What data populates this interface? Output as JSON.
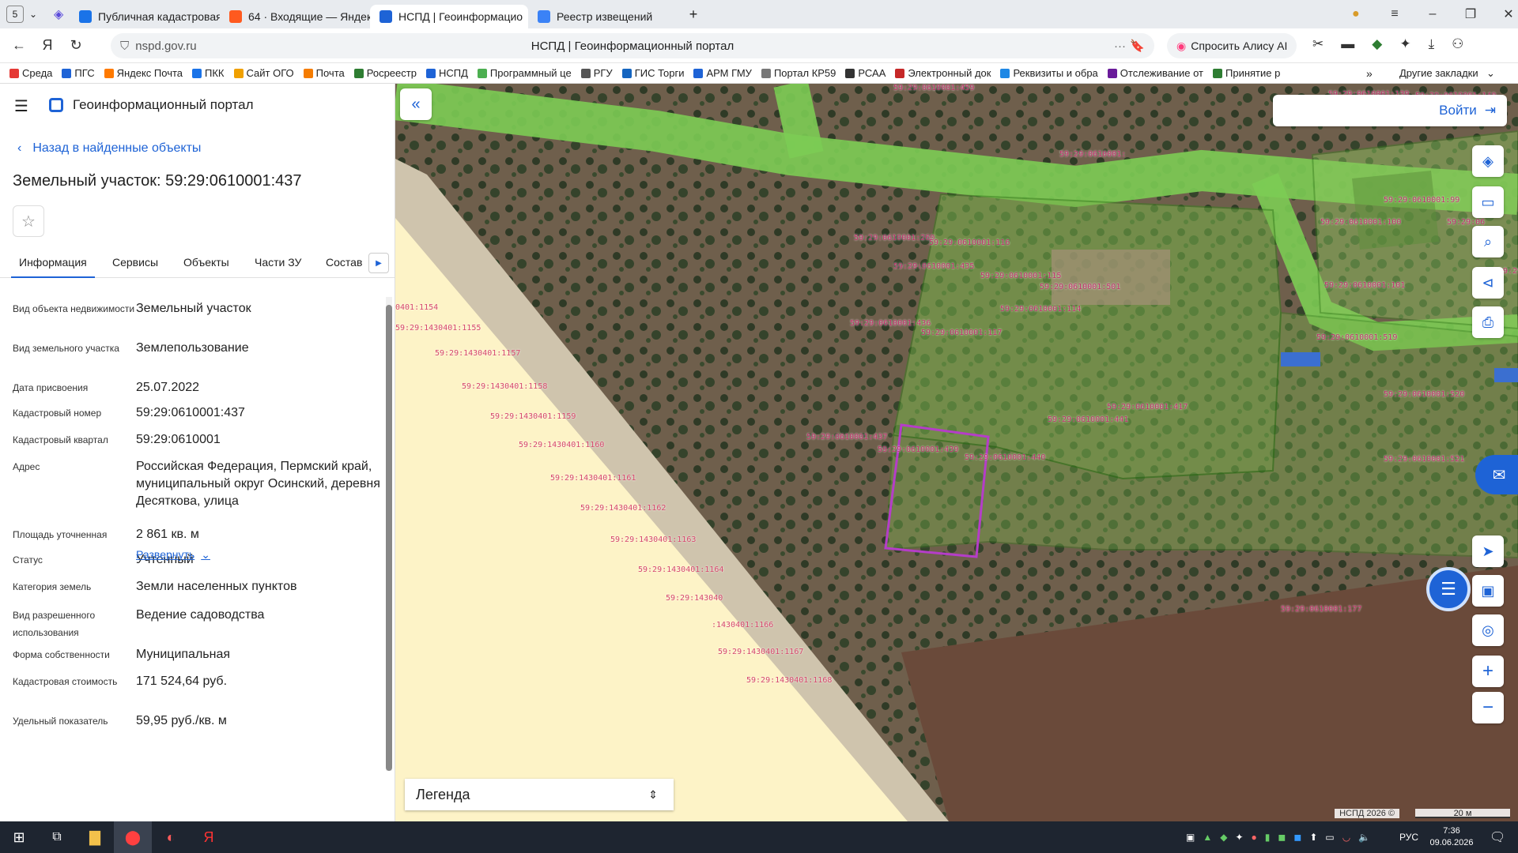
{
  "browser": {
    "tab_count": "5",
    "tabs": [
      {
        "title": "Публичная кадастровая к",
        "color": "#1a73e8"
      },
      {
        "title": "64 · Входящие — Яндекс Г",
        "color": "#ff5a1f"
      },
      {
        "title": "НСПД | Геоинформацио",
        "color": "#1e63d6"
      },
      {
        "title": "Реестр извещений",
        "color": "#3b82f6"
      }
    ],
    "url": "nspd.gov.ru",
    "page_title": "НСПД | Геоинформационный портал",
    "alice": "Спросить Алису AI"
  },
  "bookmarks": [
    {
      "l": "Среда",
      "c": "#e53935"
    },
    {
      "l": "ПГС",
      "c": "#1e63d6"
    },
    {
      "l": "Яндекс Почта",
      "c": "#ff7a00"
    },
    {
      "l": "ПКК",
      "c": "#1a73e8"
    },
    {
      "l": "Сайт ОГО",
      "c": "#f0a000"
    },
    {
      "l": "Почта",
      "c": "#f57c00"
    },
    {
      "l": "Росреестр",
      "c": "#2e7d32"
    },
    {
      "l": "НСПД",
      "c": "#1e63d6"
    },
    {
      "l": "Программный це",
      "c": "#4caf50"
    },
    {
      "l": "РГУ",
      "c": "#555"
    },
    {
      "l": "ГИС Торги",
      "c": "#1565c0"
    },
    {
      "l": "АРМ ГМУ",
      "c": "#1e63d6"
    },
    {
      "l": "Портал КР59",
      "c": "#777"
    },
    {
      "l": "РСАА",
      "c": "#333"
    },
    {
      "l": "Электронный док",
      "c": "#c62828"
    },
    {
      "l": "Реквизиты и обра",
      "c": "#1e88e5"
    },
    {
      "l": "Отслеживание от",
      "c": "#6a1b9a"
    },
    {
      "l": "Принятие р",
      "c": "#2e7d32"
    }
  ],
  "other_bookmarks": "Другие закладки",
  "portal": {
    "name": "Геоинформационный портал",
    "back": "Назад в найденные объекты",
    "title": "Земельный участок: 59:29:0610001:437",
    "tabs": [
      "Информация",
      "Сервисы",
      "Объекты",
      "Части ЗУ",
      "Состав"
    ]
  },
  "fields": [
    {
      "k": "Вид объекта недвижимости",
      "v": "Земельный участок"
    },
    {
      "k": "Вид земельного участка",
      "v": "Землепользование"
    },
    {
      "k": "Дата присвоения",
      "v": "25.07.2022"
    },
    {
      "k": "Кадастровый номер",
      "v": "59:29:0610001:437"
    },
    {
      "k": "Кадастровый квартал",
      "v": "59:29:0610001"
    },
    {
      "k": "Адрес",
      "v": "Российская Федерация, Пермский край, муниципальный округ Осинский, деревня Десяткова, улица"
    },
    {
      "k": "Площадь уточненная",
      "v": "2 861 кв. м"
    },
    {
      "k": "Статус",
      "v": "Учтенный"
    },
    {
      "k": "Категория земель",
      "v": "Земли населенных пунктов"
    },
    {
      "k": "Вид разрешенного использования",
      "v": "Ведение садоводства"
    },
    {
      "k": "Форма собственности",
      "v": "Муниципальная"
    },
    {
      "k": "Кадастровая стоимость",
      "v": "171 524,64 руб."
    },
    {
      "k": "Удельный показатель",
      "v": "59,95 руб./кв. м"
    }
  ],
  "expand": "Развернуть",
  "map": {
    "login": "Войти",
    "legend": "Легенда",
    "copyright": "НСПД 2026 ©",
    "scale": "20 м",
    "labels": [
      "59:29:0610001:459",
      "59:29:0610001:139",
      "59:29:0610001:140",
      "59:29:0610001:138",
      "59:29:0610001:",
      "59:29:0610001:99",
      "59:29:0610001:100",
      "59:29:06",
      "59:29:0610001:260",
      "59:29:0610001:116",
      "59:29:0610001:435",
      "59:29:0610001:115",
      "59:29:0610001:501",
      "59:29:0610001:101",
      "59:29:0610001:114",
      "59:29:0610001:436",
      "59:29:0610001:117",
      "59:29:0610001:519",
      "59:29:0610001:437",
      "59:29:0610001:417",
      "59:29:0610001:441",
      "59:29:0610001:439",
      "59:29:0610001:440",
      "59:29:0610001:520",
      "59:29:0610001:521",
      "59:29:0610001:177",
      "0401:1154",
      "59:29:1430401:1155",
      "59:29:1430401:1157",
      "59:29:1430401:1158",
      "59:29:1430401:1159",
      "59:29:1430401:1160",
      "59:29:1430401:1161",
      "59:29:1430401:1162",
      "59:29:1430401:1163",
      "59:29:1430401:1164",
      "59:29:143040",
      ":1430401:1166",
      "59:29:1430401:1167",
      "59:29:1430401:1168",
      "59:29:0610001:1"
    ]
  },
  "taskbar": {
    "time": "7:36",
    "date": "09.06.2026",
    "lang": "РУС"
  }
}
